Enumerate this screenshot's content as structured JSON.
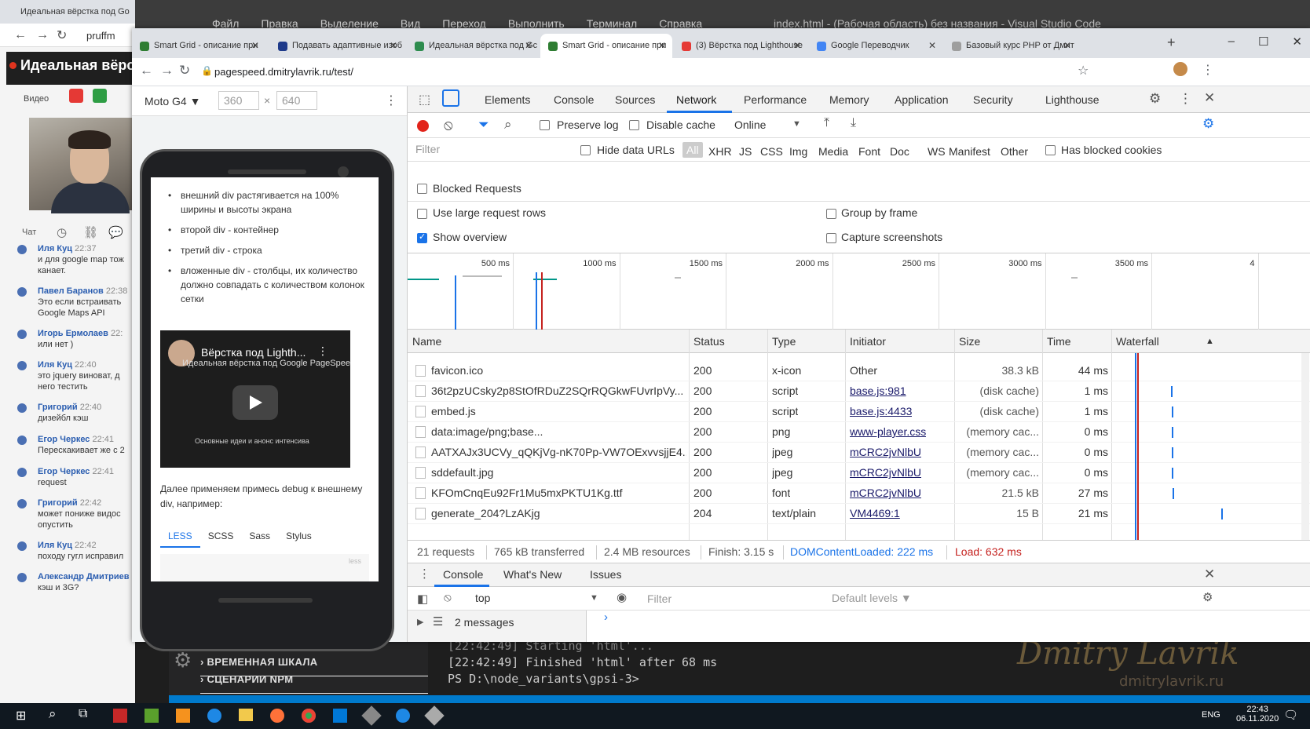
{
  "vscode": {
    "menu": [
      "Файл",
      "Правка",
      "Выделение",
      "Вид",
      "Переход",
      "Выполнить",
      "Терминал",
      "Справка"
    ],
    "title": "index.html - (Рабочая область) без названия - Visual Studio Code",
    "sidebar_sections": [
      "ВРЕМЕННАЯ ШКАЛА",
      "СЦЕНАРИИ NPM"
    ],
    "terminal_lines": [
      "[22:42:49] Starting 'html'...",
      "[22:42:49] Finished 'html' after 68 ms",
      "PS D:\\node_variants\\gpsi-3> "
    ],
    "watermark": "Dmitry Lavrik",
    "watermark_url": "dmitrylavrik.ru"
  },
  "zoom": {
    "tab_title": "Идеальная вёрстка под Go",
    "url": "pruffm",
    "banner": "Идеальная вёрст",
    "video_label": "Видео",
    "chat_label": "Чат",
    "messages": [
      {
        "who": "Иля Куц",
        "time": "22:37",
        "text": "и для google map тож канает."
      },
      {
        "who": "Павел Баранов",
        "time": "22:38",
        "text": "Это если встраивать Google Maps API"
      },
      {
        "who": "Игорь Ермолаев",
        "time": "22:",
        "text": "или нет )"
      },
      {
        "who": "Иля Куц",
        "time": "22:40",
        "text": "это jquery виноват, д него тестить"
      },
      {
        "who": "Григорий",
        "time": "22:40",
        "text": "дизейбл кэш"
      },
      {
        "who": "Егор Черкес",
        "time": "22:41",
        "text": "Перескакивает же с 2"
      },
      {
        "who": "Егор Черкес",
        "time": "22:41",
        "text": "request"
      },
      {
        "who": "Григорий",
        "time": "22:42",
        "text": "может пониже видос опустить"
      },
      {
        "who": "Иля Куц",
        "time": "22:42",
        "text": "походу гугл исправил"
      },
      {
        "who": "Александр Дмитриев",
        "time": "",
        "text": "кэш и 3G?"
      }
    ]
  },
  "chrome": {
    "tabs": [
      {
        "title": "Smart Grid - описание при",
        "color": "#2e7d32"
      },
      {
        "title": "Подавать адаптивные изоб",
        "color": "#1e3a8a"
      },
      {
        "title": "Идеальная вёрстка под Gc",
        "color": "#2d8c4e"
      },
      {
        "title": "Smart Grid - описание при",
        "color": "#2e7d32"
      },
      {
        "title": "(3) Вёрстка под Lighthouse",
        "color": "#e53935"
      },
      {
        "title": "Google Переводчик",
        "color": "#4285f4"
      },
      {
        "title": "Базовый курс PHP от Дмит",
        "color": "#9e9e9e"
      }
    ],
    "url": "pagespeed.dmitrylavrik.ru/test/"
  },
  "device": {
    "name": "Moto G4 ▼",
    "width": "360",
    "height": "640",
    "bullets": [
      "внешний div растягивается на 100% ширины и высоты экрана",
      "второй div - контейнер",
      "третий div - строка",
      "вложенные div - столбцы, их количество должно совпадать с количеством колонок сетки"
    ],
    "video_title": "Вёрстка под Lighth...",
    "video_sub": "Идеальная вёрстка под Google PageSpeed Insights и Lighthouse",
    "video_footer": "Основные идеи и анонс интенсива",
    "paragraph": "Далее применяем примесь debug к внешнему div, например:",
    "code_tabs": [
      "LESS",
      "SCSS",
      "Sass",
      "Stylus"
    ],
    "code_corner": "less"
  },
  "devtools": {
    "tabs": [
      "Elements",
      "Console",
      "Sources",
      "Network",
      "Performance",
      "Memory",
      "Application",
      "Security",
      "Lighthouse"
    ],
    "preserve_log": "Preserve log",
    "disable_cache": "Disable cache",
    "throttle": "Online",
    "filter_placeholder": "Filter",
    "hide_data_urls": "Hide data URLs",
    "types": [
      "All",
      "XHR",
      "JS",
      "CSS",
      "Img",
      "Media",
      "Font",
      "Doc",
      "WS",
      "Manifest",
      "Other"
    ],
    "has_blocked_cookies": "Has blocked cookies",
    "blocked_requests": "Blocked Requests",
    "use_large_rows": "Use large request rows",
    "group_by_frame": "Group by frame",
    "show_overview": "Show overview",
    "capture_screenshots": "Capture screenshots",
    "overview_ticks": [
      "500 ms",
      "1000 ms",
      "1500 ms",
      "2000 ms",
      "2500 ms",
      "3000 ms",
      "3500 ms",
      "4"
    ],
    "columns": [
      "Name",
      "Status",
      "Type",
      "Initiator",
      "Size",
      "Time",
      "Waterfall"
    ],
    "rows": [
      {
        "name": "favicon.ico",
        "status": "200",
        "type": "x-icon",
        "initiator": "Other",
        "link": false,
        "size": "38.3 kB",
        "time": "44 ms"
      },
      {
        "name": "36t2pzUCsky2p8StOfRDuZ2SQrRQGkwFUvrIpVy...",
        "status": "200",
        "type": "script",
        "initiator": "base.js:981",
        "link": true,
        "size": "(disk cache)",
        "time": "1 ms"
      },
      {
        "name": "embed.js",
        "status": "200",
        "type": "script",
        "initiator": "base.js:4433",
        "link": true,
        "size": "(disk cache)",
        "time": "1 ms"
      },
      {
        "name": "data:image/png;base...",
        "status": "200",
        "type": "png",
        "initiator": "www-player.css",
        "link": true,
        "size": "(memory cac...",
        "time": "0 ms"
      },
      {
        "name": "AATXAJx3UCVy_qQKjVg-nK70Pp-VW7OExvvsjjE4...",
        "status": "200",
        "type": "jpeg",
        "initiator": "mCRC2jvNlbU",
        "link": true,
        "size": "(memory cac...",
        "time": "0 ms"
      },
      {
        "name": "sddefault.jpg",
        "status": "200",
        "type": "jpeg",
        "initiator": "mCRC2jvNlbU",
        "link": true,
        "size": "(memory cac...",
        "time": "0 ms"
      },
      {
        "name": "KFOmCnqEu92Fr1Mu5mxPKTU1Kg.ttf",
        "status": "200",
        "type": "font",
        "initiator": "mCRC2jvNlbU",
        "link": true,
        "size": "21.5 kB",
        "time": "27 ms"
      },
      {
        "name": "generate_204?LzAKjg",
        "status": "204",
        "type": "text/plain",
        "initiator": "VM4469:1",
        "link": true,
        "size": "15 B",
        "time": "21 ms"
      }
    ],
    "summary": {
      "requests": "21 requests",
      "transferred": "765 kB transferred",
      "resources": "2.4 MB resources",
      "finish": "Finish: 3.15 s",
      "dcl": "DOMContentLoaded: 222 ms",
      "load": "Load: 632 ms"
    },
    "drawer_tabs": [
      "Console",
      "What's New",
      "Issues"
    ],
    "context": "top",
    "console_filter": "Filter",
    "levels": "Default levels ▼",
    "messages": "2 messages"
  },
  "taskbar": {
    "lang": "ENG",
    "time": "22:43",
    "date": "06.11.2020"
  }
}
